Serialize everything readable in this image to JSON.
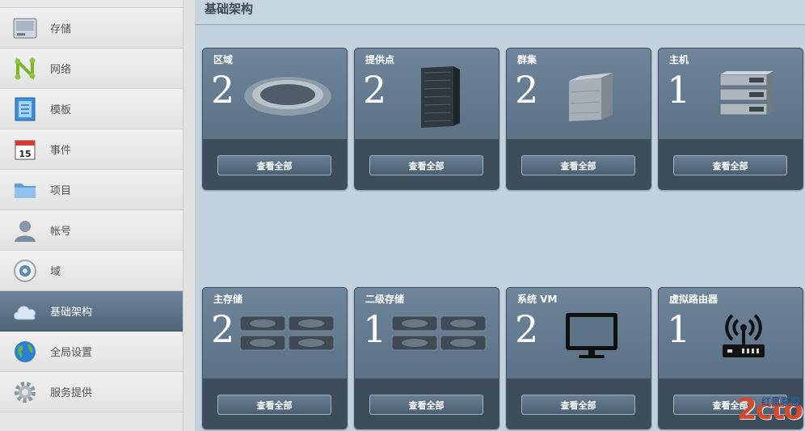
{
  "sidebar": {
    "items": [
      {
        "label": "存储",
        "icon": "storage-icon"
      },
      {
        "label": "网络",
        "icon": "network-icon"
      },
      {
        "label": "模板",
        "icon": "template-icon"
      },
      {
        "label": "事件",
        "icon": "calendar-icon"
      },
      {
        "label": "项目",
        "icon": "folder-icon"
      },
      {
        "label": "帐号",
        "icon": "user-icon"
      },
      {
        "label": "域",
        "icon": "domain-icon"
      },
      {
        "label": "基础架构",
        "icon": "cloud-icon",
        "active": true
      },
      {
        "label": "全局设置",
        "icon": "globe-icon"
      },
      {
        "label": "服务提供",
        "icon": "gear-icon"
      }
    ]
  },
  "main": {
    "title": "基础架构",
    "cards": [
      {
        "title": "区域",
        "count": "2",
        "button": "查看全部",
        "icon": "zone-ring-icon"
      },
      {
        "title": "提供点",
        "count": "2",
        "button": "查看全部",
        "icon": "pod-rack-icon"
      },
      {
        "title": "群集",
        "count": "2",
        "button": "查看全部",
        "icon": "cluster-cube-icon"
      },
      {
        "title": "主机",
        "count": "1",
        "button": "查看全部",
        "icon": "host-server-icon"
      },
      {
        "title": "主存储",
        "count": "2",
        "button": "查看全部",
        "icon": "primary-storage-icon"
      },
      {
        "title": "二级存储",
        "count": "1",
        "button": "查看全部",
        "icon": "secondary-storage-icon"
      },
      {
        "title": "系统 VM",
        "count": "2",
        "button": "查看全部",
        "icon": "monitor-icon"
      },
      {
        "title": "虚拟路由器",
        "count": "1",
        "button": "查看全部",
        "icon": "router-icon"
      }
    ]
  },
  "watermark": {
    "big": "2cto",
    "small": "红黑联盟"
  },
  "colors": {
    "active_nav": "#5a6f83",
    "card_bg": "#627890",
    "button_bg": "#556a7e",
    "page_bg": "#c2d3df"
  }
}
